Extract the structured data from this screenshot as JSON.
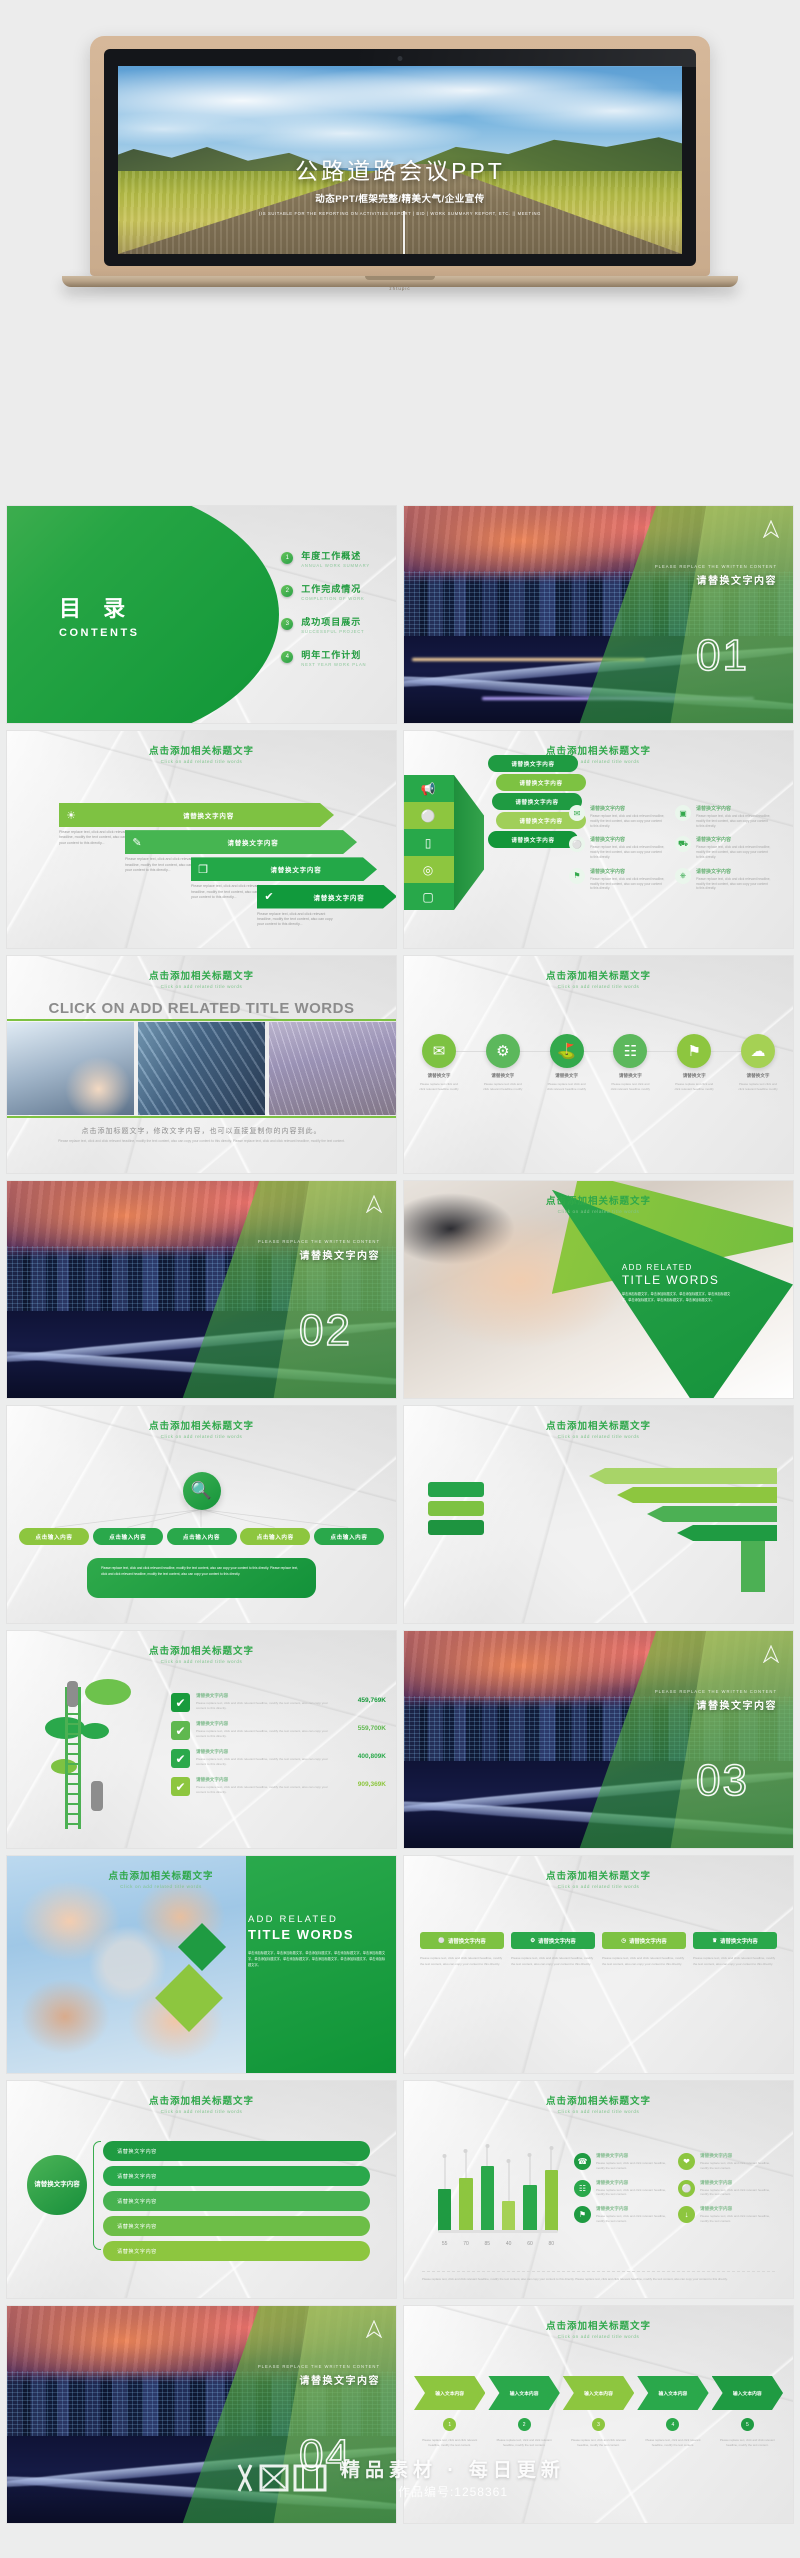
{
  "hero": {
    "title": "公路道路会议PPT",
    "subtitle": "动态PPT/框架完整/精美大气/企业宣传",
    "english_note": "(IS SUITABLE FOR THE REPORTING ON ACTIVITIES REPORT | BID | WORK SUMMARY REPORT, ETC. || MEETING",
    "laptop_brand": "zhtupic"
  },
  "common": {
    "slide_title_cn": "点击添加相关标题文字",
    "slide_title_en": "Click on add related title words",
    "replace_text": "请替换文字内容",
    "replace_text_en": "PLEASE REPLACE THE WRITTEN CONTENT",
    "input_text": "输入文本内容",
    "click_input": "点击输入内容",
    "lorem_en": "Please replace text, click and click relevant headline, modify the text content, also can copy your content to this directly.",
    "lorem_cn": "单击添加标题文字，单击添加标题文字，单击添加标题文字，单击添加标题文字。"
  },
  "contents": {
    "title_cn": "目 录",
    "title_en": "CONTENTS",
    "items": [
      {
        "num": "1",
        "cn": "年度工作概述",
        "en": "ANNUAL WORK SUMMARY"
      },
      {
        "num": "2",
        "cn": "工作完成情况",
        "en": "COMPLETION OF WORK"
      },
      {
        "num": "3",
        "cn": "成功项目展示",
        "en": "SUCCESSFUL PROJECT"
      },
      {
        "num": "4",
        "cn": "明年工作计划",
        "en": "NEXT YEAR WORK PLAN"
      }
    ]
  },
  "sections": [
    {
      "number": "01",
      "label": "请替换文字内容",
      "en": "PLEASE REPLACE THE WRITTEN CONTENT"
    },
    {
      "number": "02",
      "label": "请替换文字内容",
      "en": "PLEASE REPLACE THE WRITTEN CONTENT"
    },
    {
      "number": "03",
      "label": "请替换文字内容",
      "en": "PLEASE REPLACE THE WRITTEN CONTENT"
    },
    {
      "number": "04",
      "label": "请替换文字内容",
      "en": "PLEASE REPLACE THE WRITTEN CONTENT"
    }
  ],
  "arrows_slide": {
    "items": [
      {
        "icon": "lightbulb-icon",
        "glyph": "☀",
        "label": "请替换文字内容",
        "desc": "Please replace text, click and click relevant headline, modify the text content, also can copy your content to this directly...",
        "color": "#7ec242"
      },
      {
        "icon": "edit-icon",
        "glyph": "✎",
        "label": "请替换文字内容",
        "desc": "Please replace text, click and click relevant headline, modify the text content, also can copy your content to this directly...",
        "color": "#46b551"
      },
      {
        "icon": "copy-icon",
        "glyph": "❐",
        "label": "请替换文字内容",
        "desc": "Please replace text, click and click relevant headline, modify the text content, also can copy your content to this directly...",
        "color": "#23a848"
      },
      {
        "icon": "check-icon",
        "glyph": "✔",
        "label": "请替换文字内容",
        "desc": "Please replace text, click and click relevant headline, modify the text content, also can copy your content to this directly...",
        "color": "#119a3c"
      }
    ]
  },
  "fan_slide": {
    "segments": [
      {
        "icon": "megaphone-icon",
        "glyph": "◢",
        "color": "#28a84a"
      },
      {
        "icon": "bulb-icon",
        "glyph": "Ὂ1",
        "color": "#8dc63f"
      },
      {
        "icon": "monitor-icon",
        "glyph": "▭",
        "color": "#28a84a"
      },
      {
        "icon": "camera-lens-icon",
        "glyph": "◎",
        "color": "#8dc63f"
      },
      {
        "icon": "camera-icon",
        "glyph": "▢",
        "color": "#28a84a"
      }
    ],
    "pills": [
      {
        "label": "请替换文字内容",
        "color": "#1f9b42"
      },
      {
        "label": "请替换文字内容",
        "color": "#7dc242"
      },
      {
        "label": "请替换文字内容",
        "color": "#1f9b42"
      },
      {
        "label": "请替换文字内容",
        "color": "#a0cf5a"
      },
      {
        "label": "请替换文字内容",
        "color": "#139639"
      }
    ],
    "icon_items": [
      {
        "icon": "mail-icon",
        "glyph": "✉",
        "title": "请替换文字内容",
        "desc": "Please replace text, click and click relevant headline, modify the text content, also can copy your content to this directly."
      },
      {
        "icon": "tv-icon",
        "glyph": "▣",
        "title": "请替换文字内容",
        "desc": "Please replace text, click and click relevant headline, modify the text content, also can copy your content to this directly."
      },
      {
        "icon": "lightbulb-icon",
        "glyph": "⚬",
        "title": "请替换文字内容",
        "desc": "Please replace text, click and click relevant headline, modify the text content, also can copy your content to this directly."
      },
      {
        "icon": "car-icon",
        "glyph": "⛍",
        "title": "请替换文字内容",
        "desc": "Please replace text, click and click relevant headline, modify the text content, also can copy your content to this directly."
      },
      {
        "icon": "location-pin-icon",
        "glyph": "⚑",
        "title": "请替换文字内容",
        "desc": "Please replace text, click and click relevant headline, modify the text content, also can copy your content to this directly."
      },
      {
        "icon": "clipboard-icon",
        "glyph": "⎘",
        "title": "请替换文字内容",
        "desc": "Please replace text, click and click relevant headline, modify the text content, also can copy your content to this directly."
      }
    ]
  },
  "photos_slide": {
    "headline": "CLICK ON ADD RELATED TITLE WORDS",
    "caption_cn": "点击添加标题文字，修改文字内容，也可以直接复制你的内容到此。",
    "caption_en": "Please replace text, click and click relevant headline, modify the text content, also can copy your content to this directly. Please replace text, click and click relevant headline, modify the text content."
  },
  "circles_slide": {
    "items": [
      {
        "icon": "mail-icon",
        "glyph": "✉",
        "title": "请替换文字",
        "desc": "Please replace text click and click relevant headline modify",
        "color": "#7dc242"
      },
      {
        "icon": "gear-icon",
        "glyph": "⚙",
        "title": "请替换文字",
        "desc": "Please replace text click and click relevant headline modify",
        "color": "#5cb85c"
      },
      {
        "icon": "cart-icon",
        "glyph": "⛃",
        "title": "请替换文字",
        "desc": "Please replace text click and click relevant headline modify",
        "color": "#33a94c"
      },
      {
        "icon": "calendar-icon",
        "glyph": "☷",
        "title": "请替换文字",
        "desc": "Please replace text click and click relevant headline modify",
        "color": "#5cb85c"
      },
      {
        "icon": "pin-icon",
        "glyph": "⚑",
        "title": "请替换文字",
        "desc": "Please replace text click and click relevant headline modify",
        "color": "#8dc63f"
      },
      {
        "icon": "cloud-icon",
        "glyph": "☁",
        "title": "请替换文字",
        "desc": "Please replace text click and click relevant headline modify",
        "color": "#a5d154"
      }
    ]
  },
  "triangle_slide": {
    "line1": "ADD RELATED",
    "line2": "TITLE WORDS",
    "paragraph": "单击添加标题文字，单击添加标题文字，单击添加标题文字，单击添加标题文字，单击添加标题文字，单击添加标题文字，单击添加标题文字。"
  },
  "search_slide": {
    "hub_icon": "search-icon",
    "pills": [
      {
        "label": "点击输入内容",
        "color": "#8dc63f"
      },
      {
        "label": "点击输入内容",
        "color": "#2aa84b"
      },
      {
        "label": "点击输入内容",
        "color": "#2aa84b"
      },
      {
        "label": "点击输入内容",
        "color": "#8dc63f"
      },
      {
        "label": "点击输入内容",
        "color": "#2aa84b"
      }
    ],
    "box_text": "Please replace text, click and click relevant headline, modify the text content, also can copy your content to this directly. Please replace text, click and click relevant headline, modify the text content, also can copy your content to this directly."
  },
  "bigarrows_slide": {
    "boxes": [
      {
        "color": "#26a44a"
      },
      {
        "color": "#7dc242"
      },
      {
        "color": "#1e9440"
      }
    ],
    "arrows": [
      {
        "color": "#a8d468"
      },
      {
        "color": "#8dc63f"
      },
      {
        "color": "#4cb054"
      },
      {
        "color": "#1f9b42"
      }
    ]
  },
  "ladder_slide": {
    "rows": [
      {
        "title": "请替换文字内容",
        "desc": "Please replace text, click and click relevant headline, modify the text content, also can copy your content to this directly.",
        "value": "459,769K",
        "color": "#189b3c"
      },
      {
        "title": "请替换文字内容",
        "desc": "Please replace text, click and click relevant headline, modify the text content, also can copy your content to this directly.",
        "value": "559,700K",
        "color": "#5fb84f"
      },
      {
        "title": "请替换文字内容",
        "desc": "Please replace text, click and click relevant headline, modify the text content, also can copy your content to this directly.",
        "value": "400,809K",
        "color": "#2ba94b"
      },
      {
        "title": "请替换文字内容",
        "desc": "Please replace text, click and click relevant headline, modify the text content, also can copy your content to this directly.",
        "value": "909,369K",
        "color": "#8dc63f"
      }
    ]
  },
  "teamwork_slide": {
    "line1": "ADD RELATED",
    "line2": "TITLE WORDS",
    "paragraph": "单击添加标题文字，单击添加标题文字，单击添加标题文字，单击添加标题文字，单击添加标题文字，单击添加标题文字，单击添加标题文字，单击添加标题文字，单击添加标题文字，单击添加标题文字。"
  },
  "pills4_slide": {
    "items": [
      {
        "icon": "bulb-icon",
        "glyph": "⚬",
        "label": "请替换文字内容",
        "color": "#7dc242",
        "desc": "Please replace text, click and click relevant headline, modify the text content, also can copy your content to this directly."
      },
      {
        "icon": "gear-icon",
        "glyph": "⚙",
        "label": "请替换文字内容",
        "color": "#2aa84b",
        "desc": "Please replace text, click and click relevant headline, modify the text content, also can copy your content to this directly."
      },
      {
        "icon": "clock-icon",
        "glyph": "◷",
        "label": "请替换文字内容",
        "color": "#7dc242",
        "desc": "Please replace text, click and click relevant headline, modify the text content, also can copy your content to this directly."
      },
      {
        "icon": "trophy-icon",
        "glyph": "♛",
        "label": "请替换文字内容",
        "color": "#2aa84b",
        "desc": "Please replace text, click and click relevant headline, modify the text content, also can copy your content to this directly."
      }
    ]
  },
  "greenpills_slide": {
    "circle_label": "请替换文字内容",
    "items": [
      {
        "label": "请替换文字内容",
        "color": "#1f9b42"
      },
      {
        "label": "请替换文字内容",
        "color": "#2aa84b"
      },
      {
        "label": "请替换文字内容",
        "color": "#47b250"
      },
      {
        "label": "请替换文字内容",
        "color": "#6dbe47"
      },
      {
        "label": "请替换文字内容",
        "color": "#8dc63f"
      }
    ]
  },
  "chevron_slide": {
    "items": [
      {
        "label": "输入文本内容",
        "num": "1",
        "color": "#8dc63f",
        "desc": "Please replace text, click and click relevant headline, modify the text content."
      },
      {
        "label": "输入文本内容",
        "num": "2",
        "color": "#2aa84b",
        "desc": "Please replace text, click and click relevant headline, modify the text content."
      },
      {
        "label": "输入文本内容",
        "num": "3",
        "color": "#8dc63f",
        "desc": "Please replace text, click and click relevant headline, modify the text content."
      },
      {
        "label": "输入文本内容",
        "num": "4",
        "color": "#2aa84b",
        "desc": "Please replace text, click and click relevant headline, modify the text content."
      },
      {
        "label": "输入文本内容",
        "num": "5",
        "color": "#1f9b42",
        "desc": "Please replace text, click and click relevant headline, modify the text content."
      }
    ]
  },
  "chart_data": {
    "type": "bar",
    "title": "点击添加相关标题文字",
    "subtitle": "Click on add related title words",
    "categories": [
      "55",
      "70",
      "85",
      "40",
      "60",
      "80"
    ],
    "values": [
      55,
      70,
      85,
      40,
      60,
      80
    ],
    "colors": [
      "#1f9b42",
      "#8dc63f",
      "#2aa84b",
      "#a5d154",
      "#2aa84b",
      "#8dc63f"
    ],
    "xlabel": "",
    "ylabel": "",
    "ylim": [
      0,
      100
    ],
    "grid": false,
    "legend": "none",
    "footnote": "Please replace text, click and click relevant headline, modify the text content, also can copy your content to this directly. Please replace text, click and click relevant headline, modify the text content, also can copy your content to this directly.",
    "side_items": [
      {
        "icon": "phone-icon",
        "glyph": "☎",
        "title": "请替换文字内容",
        "desc": "Please replace text, click and click relevant headline, modify the text content.",
        "color": "#1f9b42"
      },
      {
        "icon": "heart-icon",
        "glyph": "❤",
        "title": "请替换文字内容",
        "desc": "Please replace text, click and click relevant headline, modify the text content.",
        "color": "#8dc63f"
      },
      {
        "icon": "calendar-icon",
        "glyph": "☷",
        "title": "请替换文字内容",
        "desc": "Please replace text, click and click relevant headline, modify the text content.",
        "color": "#2aa84b"
      },
      {
        "icon": "bulb-icon",
        "glyph": "⚬",
        "title": "请替换文字内容",
        "desc": "Please replace text, click and click relevant headline, modify the text content.",
        "color": "#8dc63f"
      },
      {
        "icon": "pin-icon",
        "glyph": "⚑",
        "title": "请替换文字内容",
        "desc": "Please replace text, click and click relevant headline, modify the text content.",
        "color": "#1f9b42"
      },
      {
        "icon": "download-icon",
        "glyph": "⤓",
        "title": "请替换文字内容",
        "desc": "Please replace text, click and click relevant headline, modify the text content.",
        "color": "#8dc63f"
      }
    ]
  },
  "watermark": {
    "logo_text": "众图网",
    "tagline": "精品素材 · 每日更新",
    "work_id": "作品编号:1258361"
  },
  "colors": {
    "brand_green": "#2aa84b",
    "light_green": "#8dc63f",
    "dark_green": "#13923a"
  }
}
